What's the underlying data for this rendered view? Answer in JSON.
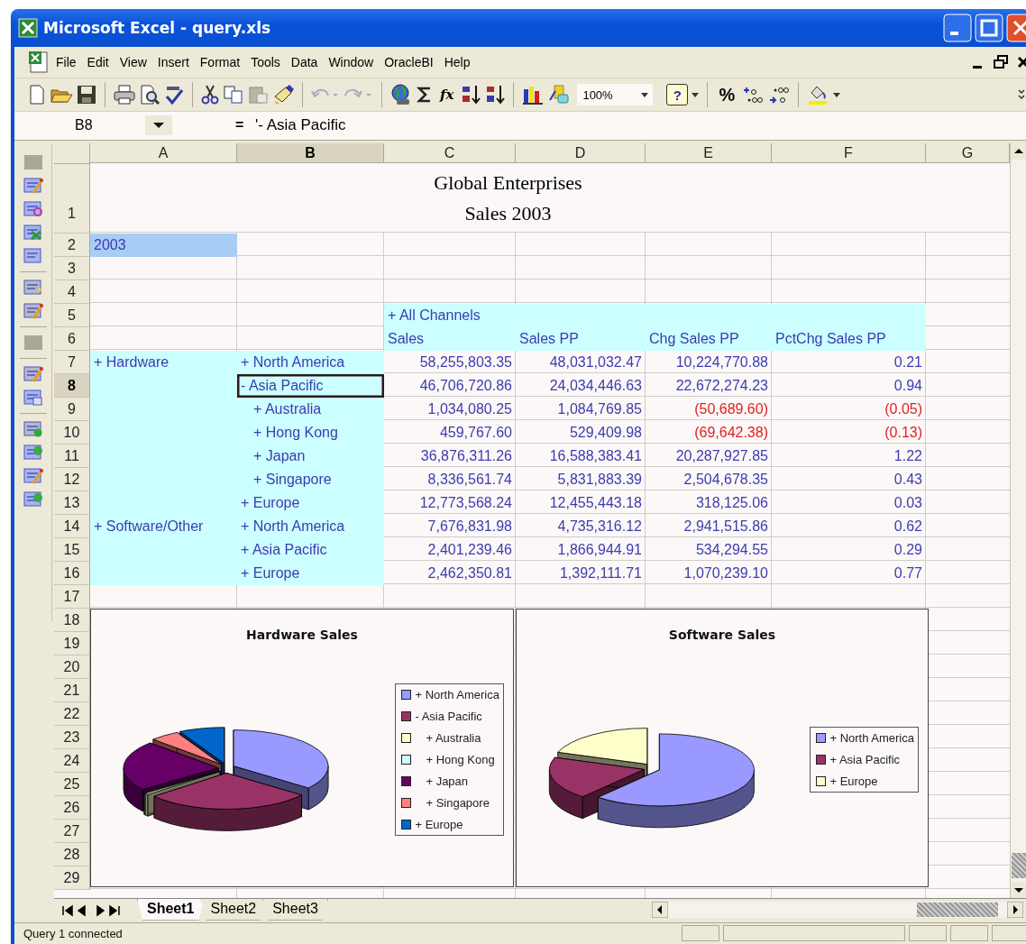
{
  "window": {
    "title": "Microsoft Excel - query.xls"
  },
  "menu": [
    "File",
    "Edit",
    "View",
    "Insert",
    "Format",
    "Tools",
    "Data",
    "Window",
    "OracleBI",
    "Help"
  ],
  "toolbar": {
    "function": "fx",
    "zoom": "100%",
    "help": "?",
    "percent": "%"
  },
  "formula_bar": {
    "name_box": "B8",
    "equals": "=",
    "value": "'- Asia Pacific"
  },
  "sheet": {
    "columns": [
      {
        "label": "A",
        "selected": false
      },
      {
        "label": "B",
        "selected": true
      },
      {
        "label": "C",
        "selected": false
      },
      {
        "label": "D",
        "selected": false
      },
      {
        "label": "E",
        "selected": false
      },
      {
        "label": "F",
        "selected": false
      },
      {
        "label": "G",
        "selected": false
      }
    ],
    "rows": [
      {
        "number": "1",
        "selected": false,
        "title_lines": [
          "Global Enterprises",
          "Sales 2003"
        ]
      },
      {
        "number": "2",
        "selected": false,
        "cells": [
          {
            "text": "2003",
            "kind": "year"
          },
          null,
          null,
          null,
          null,
          null
        ]
      },
      {
        "number": "3",
        "selected": false
      },
      {
        "number": "4",
        "selected": false
      },
      {
        "number": "5",
        "selected": false,
        "cells": [
          null,
          null,
          {
            "text": "+ All Channels",
            "kind": "heading"
          },
          {
            "kind": "heading"
          },
          {
            "kind": "heading"
          },
          {
            "kind": "heading"
          }
        ]
      },
      {
        "number": "6",
        "selected": false,
        "cells": [
          null,
          null,
          {
            "text": "Sales",
            "kind": "heading"
          },
          {
            "text": "Sales PP",
            "kind": "heading"
          },
          {
            "text": "Chg Sales PP",
            "kind": "heading"
          },
          {
            "text": "PctChg Sales PP",
            "kind": "heading"
          }
        ]
      },
      {
        "number": "7",
        "selected": false,
        "cells": [
          {
            "text": "+ Hardware",
            "kind": "member"
          },
          {
            "text": "+ North America",
            "kind": "member"
          },
          {
            "text": "58,255,803.35",
            "kind": "number"
          },
          {
            "text": "48,031,032.47",
            "kind": "number"
          },
          {
            "text": "10,224,770.88",
            "kind": "number"
          },
          {
            "text": "0.21",
            "kind": "number"
          }
        ]
      },
      {
        "number": "8",
        "selected": true,
        "cells": [
          {
            "kind": "member"
          },
          {
            "text": "- Asia Pacific",
            "kind": "member"
          },
          {
            "text": "46,706,720.86",
            "kind": "number"
          },
          {
            "text": "24,034,446.63",
            "kind": "number"
          },
          {
            "text": "22,672,274.23",
            "kind": "number"
          },
          {
            "text": "0.94",
            "kind": "number"
          }
        ]
      },
      {
        "number": "9",
        "selected": false,
        "cells": [
          {
            "kind": "member"
          },
          {
            "text": "+ Australia",
            "kind": "child"
          },
          {
            "text": "1,034,080.25",
            "kind": "number"
          },
          {
            "text": "1,084,769.85",
            "kind": "number"
          },
          {
            "text": "(50,689.60)",
            "kind": "negative"
          },
          {
            "text": "(0.05)",
            "kind": "negative"
          }
        ]
      },
      {
        "number": "10",
        "selected": false,
        "cells": [
          {
            "kind": "member"
          },
          {
            "text": "+ Hong Kong",
            "kind": "child"
          },
          {
            "text": "459,767.60",
            "kind": "number"
          },
          {
            "text": "529,409.98",
            "kind": "number"
          },
          {
            "text": "(69,642.38)",
            "kind": "negative"
          },
          {
            "text": "(0.13)",
            "kind": "negative"
          }
        ]
      },
      {
        "number": "11",
        "selected": false,
        "cells": [
          {
            "kind": "member"
          },
          {
            "text": "+ Japan",
            "kind": "child"
          },
          {
            "text": "36,876,311.26",
            "kind": "number"
          },
          {
            "text": "16,588,383.41",
            "kind": "number"
          },
          {
            "text": "20,287,927.85",
            "kind": "number"
          },
          {
            "text": "1.22",
            "kind": "number"
          }
        ]
      },
      {
        "number": "12",
        "selected": false,
        "cells": [
          {
            "kind": "member"
          },
          {
            "text": "+ Singapore",
            "kind": "child"
          },
          {
            "text": "8,336,561.74",
            "kind": "number"
          },
          {
            "text": "5,831,883.39",
            "kind": "number"
          },
          {
            "text": "2,504,678.35",
            "kind": "number"
          },
          {
            "text": "0.43",
            "kind": "number"
          }
        ]
      },
      {
        "number": "13",
        "selected": false,
        "cells": [
          {
            "kind": "member"
          },
          {
            "text": "+ Europe",
            "kind": "member"
          },
          {
            "text": "12,773,568.24",
            "kind": "number"
          },
          {
            "text": "12,455,443.18",
            "kind": "number"
          },
          {
            "text": "318,125.06",
            "kind": "number"
          },
          {
            "text": "0.03",
            "kind": "number"
          }
        ]
      },
      {
        "number": "14",
        "selected": false,
        "cells": [
          {
            "text": "+ Software/Other",
            "kind": "member"
          },
          {
            "text": "+ North America",
            "kind": "member"
          },
          {
            "text": "7,676,831.98",
            "kind": "number"
          },
          {
            "text": "4,735,316.12",
            "kind": "number"
          },
          {
            "text": "2,941,515.86",
            "kind": "number"
          },
          {
            "text": "0.62",
            "kind": "number"
          }
        ]
      },
      {
        "number": "15",
        "selected": false,
        "cells": [
          {
            "kind": "member"
          },
          {
            "text": "+ Asia Pacific",
            "kind": "member"
          },
          {
            "text": "2,401,239.46",
            "kind": "number"
          },
          {
            "text": "1,866,944.91",
            "kind": "number"
          },
          {
            "text": "534,294.55",
            "kind": "number"
          },
          {
            "text": "0.29",
            "kind": "number"
          }
        ]
      },
      {
        "number": "16",
        "selected": false,
        "cells": [
          {
            "kind": "member"
          },
          {
            "text": "+ Europe",
            "kind": "member"
          },
          {
            "text": "2,462,350.81",
            "kind": "number"
          },
          {
            "text": "1,392,111.71",
            "kind": "number"
          },
          {
            "text": "1,070,239.10",
            "kind": "number"
          },
          {
            "text": "0.77",
            "kind": "number"
          }
        ]
      },
      {
        "number": "17",
        "selected": false
      },
      {
        "number": "18",
        "selected": false
      },
      {
        "number": "19",
        "selected": false
      },
      {
        "number": "20",
        "selected": false
      },
      {
        "number": "21",
        "selected": false
      },
      {
        "number": "22",
        "selected": false
      },
      {
        "number": "23",
        "selected": false
      },
      {
        "number": "24",
        "selected": false
      },
      {
        "number": "25",
        "selected": false
      },
      {
        "number": "26",
        "selected": false
      },
      {
        "number": "27",
        "selected": false
      },
      {
        "number": "28",
        "selected": false
      },
      {
        "number": "29",
        "selected": false
      }
    ]
  },
  "charts": [
    {
      "title": "Hardware Sales",
      "legend": [
        {
          "label": "+ North America",
          "color": "#9999ff",
          "kind": "member"
        },
        {
          "label": "- Asia Pacific",
          "color": "#993366",
          "kind": "member"
        },
        {
          "label": "+ Australia",
          "color": "#ffffcc",
          "kind": "child"
        },
        {
          "label": "+ Hong Kong",
          "color": "#ccffff",
          "kind": "child"
        },
        {
          "label": "+ Japan",
          "color": "#660066",
          "kind": "child"
        },
        {
          "label": "+ Singapore",
          "color": "#ff8080",
          "kind": "child"
        },
        {
          "label": "+ Europe",
          "color": "#0066cc",
          "kind": "member"
        }
      ]
    },
    {
      "title": "Software Sales",
      "legend": [
        {
          "label": "+ North America",
          "color": "#9999ff",
          "kind": "member"
        },
        {
          "label": "+ Asia Pacific",
          "color": "#993366",
          "kind": "member"
        },
        {
          "label": "+ Europe",
          "color": "#ffffcc",
          "kind": "member"
        }
      ]
    }
  ],
  "sheet_tabs": [
    {
      "label": "Sheet1",
      "selected": true
    },
    {
      "label": "Sheet2",
      "selected": false
    },
    {
      "label": "Sheet3",
      "selected": false
    }
  ],
  "status_bar": {
    "text": "Query 1 connected"
  }
}
